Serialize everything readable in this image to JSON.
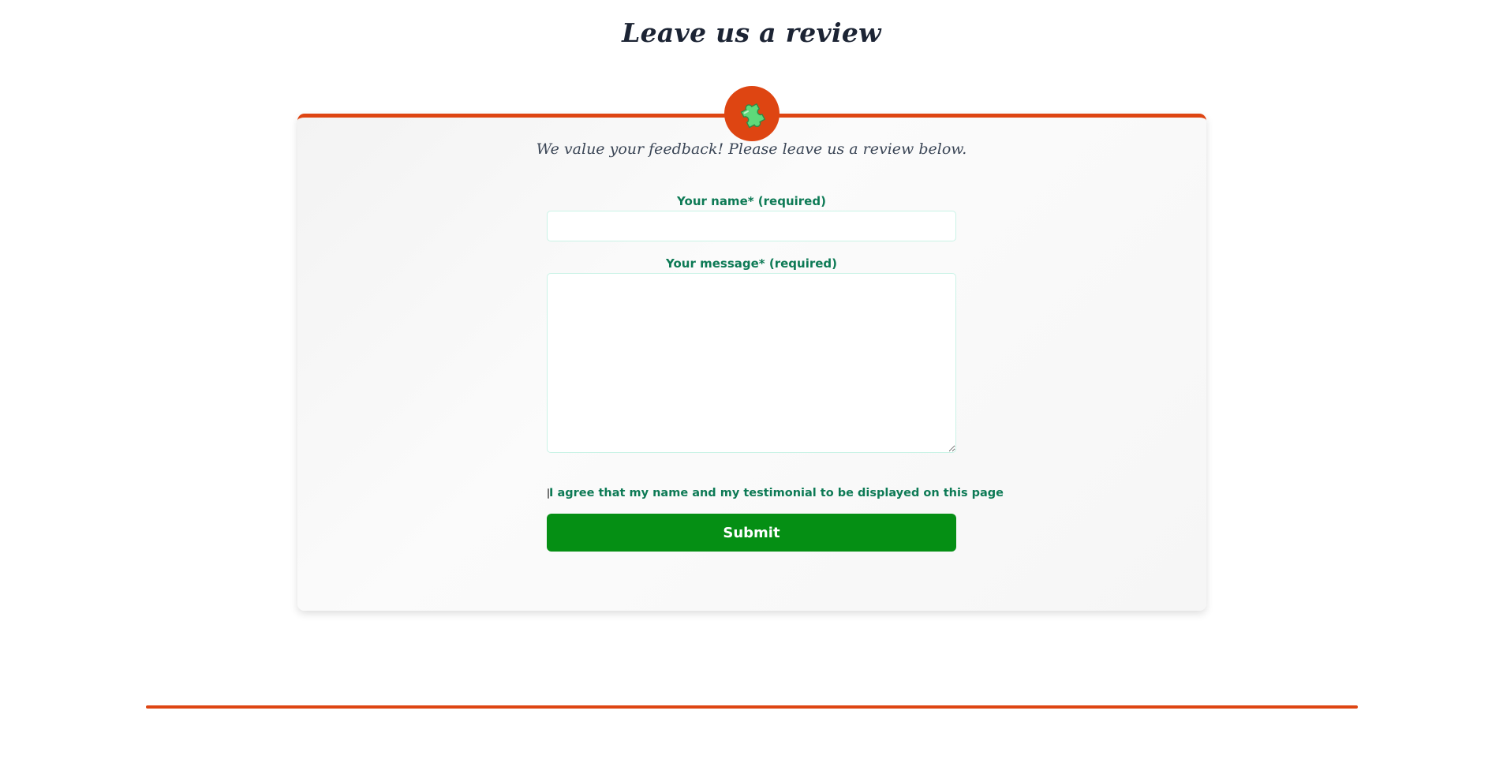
{
  "page": {
    "title": "Leave us a review"
  },
  "review_form": {
    "badge_icon": "puzzle-piece-icon",
    "intro_text": "We value your feedback! Please leave us a review below.",
    "name_label": "Your name* (required)",
    "name_value": "",
    "message_label": "Your message* (required)",
    "message_value": "",
    "agree_label": "I agree that my name and my testimonial to be displayed on this page",
    "agree_checked": false,
    "submit_label": "Submit"
  },
  "colors": {
    "accent": "#de4512",
    "label_green": "#0d7a55",
    "submit_green": "#058f14",
    "title": "#1c2434",
    "puzzle_green": "#5ed97a"
  }
}
